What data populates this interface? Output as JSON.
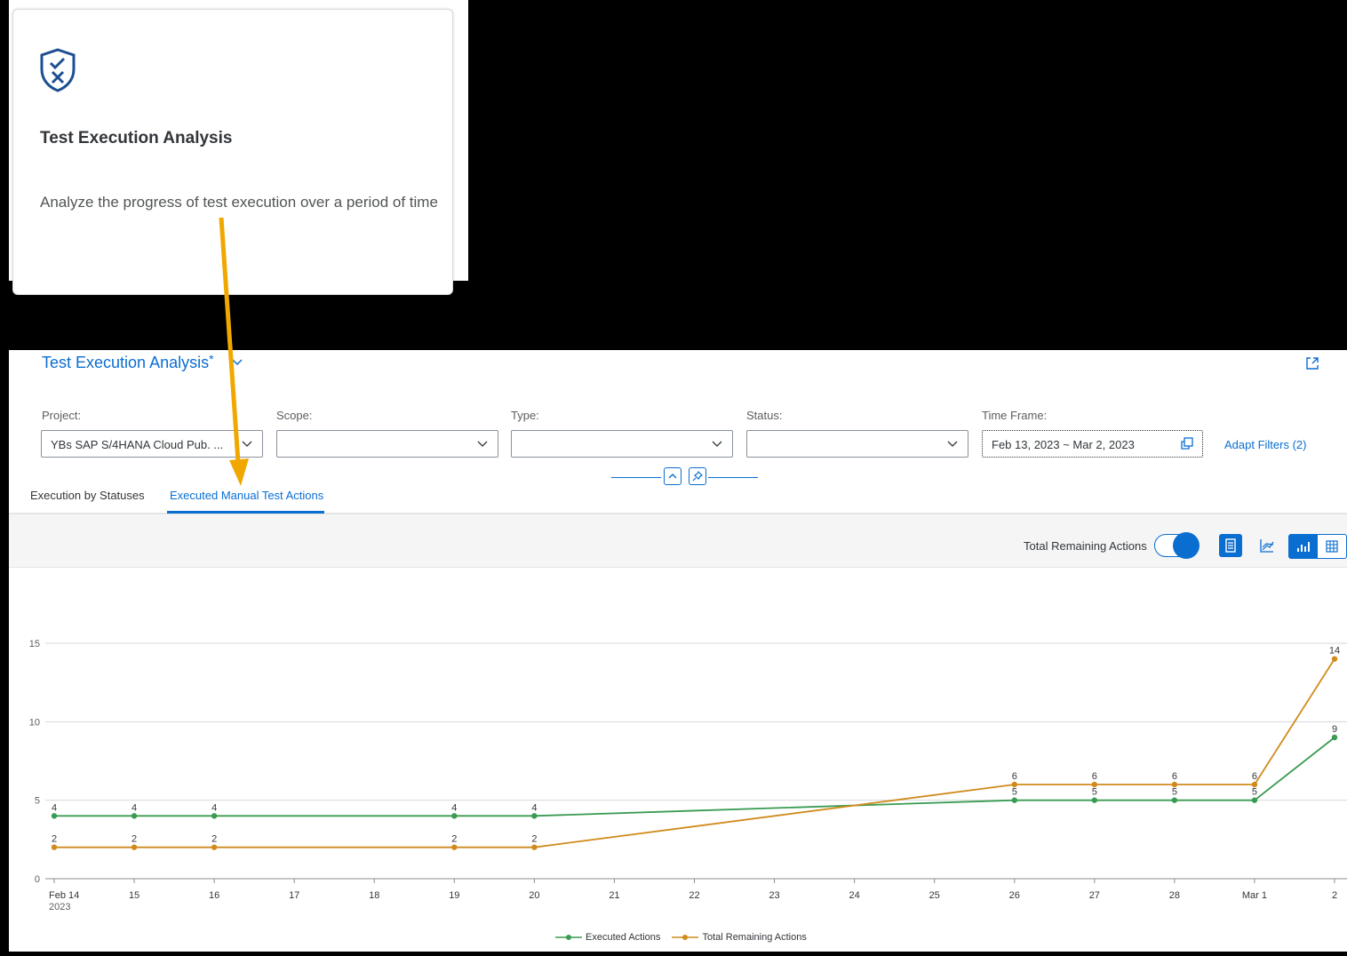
{
  "tile": {
    "icon": "shield-check-x-icon",
    "title": "Test Execution Analysis",
    "description": "Analyze the progress of test execution over a period of time"
  },
  "header": {
    "view_title": "Test Execution Analysis",
    "view_modified_marker": "*"
  },
  "filters": {
    "project": {
      "label": "Project:",
      "value": "YBs SAP S/4HANA Cloud Pub. ..."
    },
    "scope": {
      "label": "Scope:",
      "value": ""
    },
    "type": {
      "label": "Type:",
      "value": ""
    },
    "status": {
      "label": "Status:",
      "value": ""
    },
    "time_frame": {
      "label": "Time Frame:",
      "value": "Feb 13, 2023 ~ Mar 2, 2023"
    },
    "adapt_filters": "Adapt Filters (2)"
  },
  "tabs": [
    {
      "label": "Execution by Statuses",
      "selected": false
    },
    {
      "label": "Executed Manual Test Actions",
      "selected": true
    }
  ],
  "toolbar": {
    "toggle_label": "Total Remaining Actions",
    "toggle_on": true
  },
  "colors": {
    "accent": "#0a6ed1",
    "executed": "#3a9b52",
    "remaining": "#d08b1c",
    "annotation_arrow": "#f0a800"
  },
  "chart_data": {
    "type": "line",
    "x": [
      "Feb 14",
      "15",
      "16",
      "17",
      "18",
      "19",
      "20",
      "21",
      "22",
      "23",
      "24",
      "25",
      "26",
      "27",
      "28",
      "Mar 1",
      "2"
    ],
    "x_sub_label": "2023",
    "ylim": [
      0,
      15
    ],
    "yticks": [
      0,
      5,
      10,
      15
    ],
    "grid": true,
    "legend_position": "bottom",
    "series": [
      {
        "name": "Executed Actions",
        "color": "#3a9b52",
        "points": [
          [
            "Feb 14",
            4
          ],
          [
            "15",
            4
          ],
          [
            "16",
            4
          ],
          [
            "19",
            4
          ],
          [
            "20",
            4
          ],
          [
            "26",
            5
          ],
          [
            "27",
            5
          ],
          [
            "28",
            5
          ],
          [
            "Mar 1",
            5
          ],
          [
            "2",
            9
          ]
        ]
      },
      {
        "name": "Total Remaining Actions",
        "color": "#d08b1c",
        "points": [
          [
            "Feb 14",
            2
          ],
          [
            "15",
            2
          ],
          [
            "16",
            2
          ],
          [
            "19",
            2
          ],
          [
            "20",
            2
          ],
          [
            "26",
            6
          ],
          [
            "27",
            6
          ],
          [
            "28",
            6
          ],
          [
            "Mar 1",
            6
          ],
          [
            "2",
            14
          ]
        ]
      }
    ]
  }
}
